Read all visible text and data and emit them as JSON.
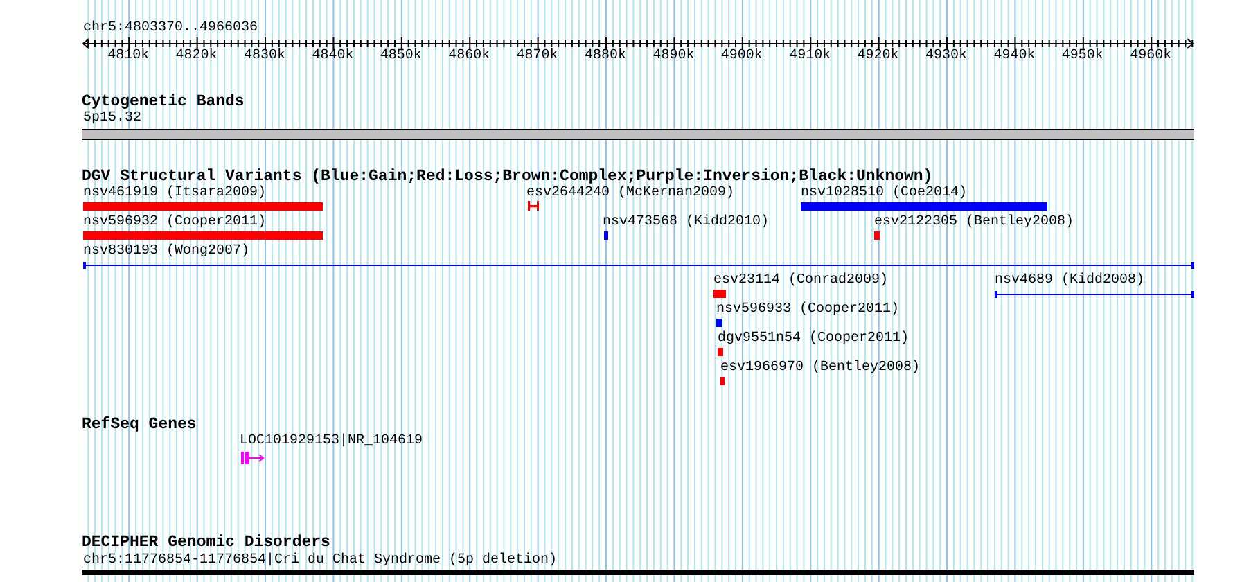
{
  "ruler": {
    "title": "chr5:4803370..4966036",
    "ticks": [
      "4810k",
      "4820k",
      "4830k",
      "4840k",
      "4850k",
      "4860k",
      "4870k",
      "4880k",
      "4890k",
      "4900k",
      "4910k",
      "4920k",
      "4930k",
      "4940k",
      "4950k",
      "4960k"
    ]
  },
  "cytobands": {
    "title": "Cytogenetic Bands",
    "label": "5p15.32"
  },
  "dgv": {
    "title": "DGV Structural Variants (Blue:Gain;Red:Loss;Brown:Complex;Purple:Inversion;Black:Unknown)",
    "features": [
      {
        "label": "nsv461919 (Itsara2009)",
        "kind": "bar",
        "color": "#ff0000"
      },
      {
        "label": "esv2644240 (McKernan2009)",
        "kind": "interval",
        "color": "#ff0000"
      },
      {
        "label": "nsv1028510 (Coe2014)",
        "kind": "bar",
        "color": "#0000ff"
      },
      {
        "label": "nsv596932 (Cooper2011)",
        "kind": "bar",
        "color": "#ff0000"
      },
      {
        "label": "nsv473568 (Kidd2010)",
        "kind": "bar",
        "color": "#0000ff"
      },
      {
        "label": "esv2122305 (Bentley2008)",
        "kind": "bar",
        "color": "#ff0000"
      },
      {
        "label": "nsv830193 (Wong2007)",
        "kind": "line",
        "color": "#0000ff"
      },
      {
        "label": "esv23114 (Conrad2009)",
        "kind": "bar",
        "color": "#ff0000"
      },
      {
        "label": "nsv4689 (Kidd2008)",
        "kind": "line",
        "color": "#0000ff"
      },
      {
        "label": "nsv596933 (Cooper2011)",
        "kind": "bar",
        "color": "#0000ff"
      },
      {
        "label": "dgv9551n54 (Cooper2011)",
        "kind": "bar",
        "color": "#ff0000"
      },
      {
        "label": "esv1966970 (Bentley2008)",
        "kind": "bar",
        "color": "#ff0000"
      }
    ]
  },
  "refseq": {
    "title": "RefSeq Genes",
    "genes": [
      {
        "label": "LOC101929153|NR_104619",
        "color": "#ff00ff"
      }
    ]
  },
  "decipher": {
    "title": "DECIPHER Genomic Disorders",
    "label": "chr5:11776854-11776854|Cri du Chat Syndrome (5p deletion)"
  }
}
